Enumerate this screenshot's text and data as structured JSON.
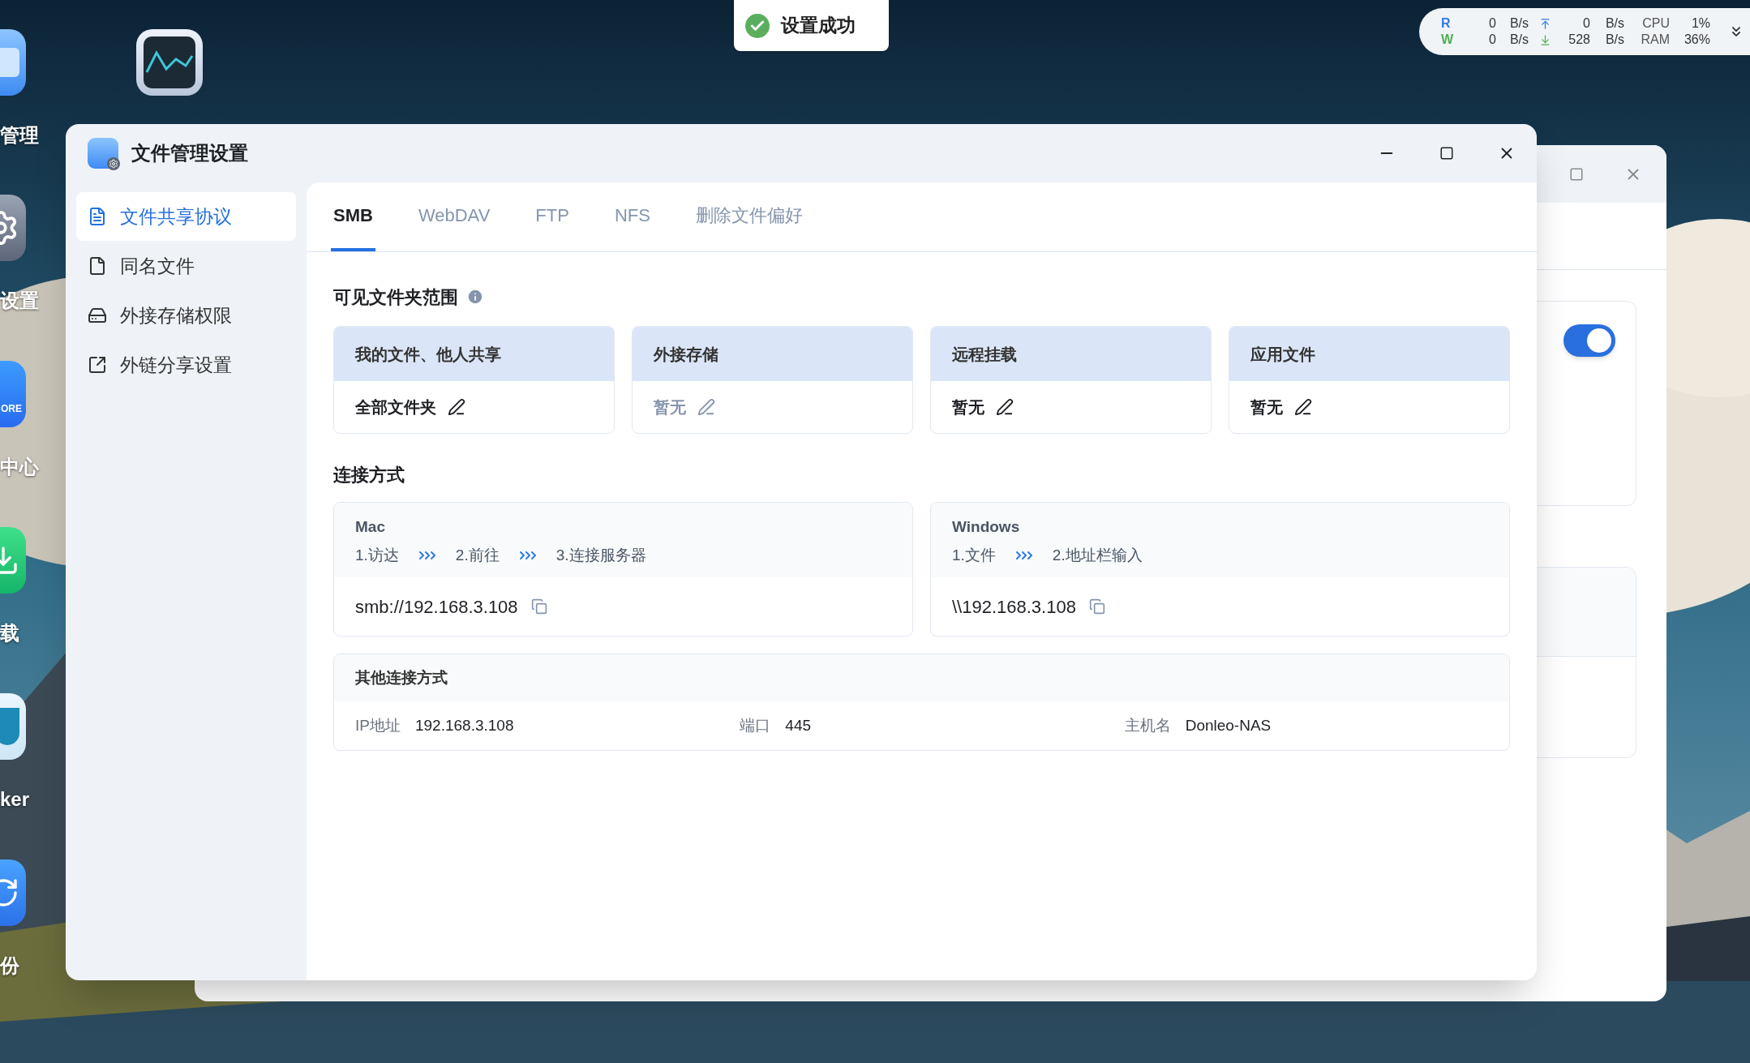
{
  "toast": {
    "text": "设置成功"
  },
  "net_monitor": {
    "rows": [
      {
        "label": "R",
        "color": "#2f7ae5",
        "rate": "0",
        "rate_unit": "B/s",
        "kind": "up",
        "speed": "0",
        "speed_unit": "B/s",
        "metric": "CPU",
        "value": "1%"
      },
      {
        "label": "W",
        "color": "#4caf50",
        "rate": "0",
        "rate_unit": "B/s",
        "kind": "down",
        "speed": "528",
        "speed_unit": "B/s",
        "metric": "RAM",
        "value": "36%"
      }
    ]
  },
  "desktop_icons": [
    {
      "kind": "folder",
      "label": "管理"
    },
    {
      "kind": "gear",
      "label": "设置"
    },
    {
      "kind": "store",
      "badge_text": "ORE",
      "label": "中心"
    },
    {
      "kind": "download",
      "label": "载"
    },
    {
      "kind": "docker",
      "label": "ker"
    },
    {
      "kind": "backup",
      "label": "份"
    }
  ],
  "monitor_icon": {
    "kind": "monitor"
  },
  "back_window": {
    "toggle": {
      "on": true
    }
  },
  "window": {
    "title": "文件管理设置"
  },
  "sidebar": {
    "items": [
      {
        "kind": "document",
        "label": "文件共享协议",
        "selected": true
      },
      {
        "kind": "file",
        "label": "同名文件",
        "selected": false
      },
      {
        "kind": "drive",
        "label": "外接存储权限",
        "selected": false
      },
      {
        "kind": "share",
        "label": "外链分享设置",
        "selected": false
      }
    ]
  },
  "tabs": [
    {
      "label": "SMB",
      "selected": true
    },
    {
      "label": "WebDAV",
      "selected": false
    },
    {
      "label": "FTP",
      "selected": false
    },
    {
      "label": "NFS",
      "selected": false
    },
    {
      "label": "删除文件偏好",
      "selected": false
    }
  ],
  "visible_scope": {
    "title": "可见文件夹范围",
    "cards": [
      {
        "header": "我的文件、他人共享",
        "value": "全部文件夹",
        "disabled": false
      },
      {
        "header": "外接存储",
        "value": "暂无",
        "disabled": true
      },
      {
        "header": "远程挂载",
        "value": "暂无",
        "disabled": false
      },
      {
        "header": "应用文件",
        "value": "暂无",
        "disabled": false
      }
    ]
  },
  "connection": {
    "title": "连接方式",
    "methods": [
      {
        "os": "Mac",
        "steps": [
          "1.访达",
          "2.前往",
          "3.连接服务器"
        ],
        "address": "smb://192.168.3.108"
      },
      {
        "os": "Windows",
        "steps": [
          "1.文件",
          "2.地址栏输入"
        ],
        "address": "\\\\192.168.3.108"
      }
    ]
  },
  "other_connection": {
    "title": "其他连接方式",
    "fields": [
      {
        "label": "IP地址",
        "value": "192.168.3.108"
      },
      {
        "label": "端口",
        "value": "445"
      },
      {
        "label": "主机名",
        "value": "Donleo-NAS"
      }
    ]
  }
}
